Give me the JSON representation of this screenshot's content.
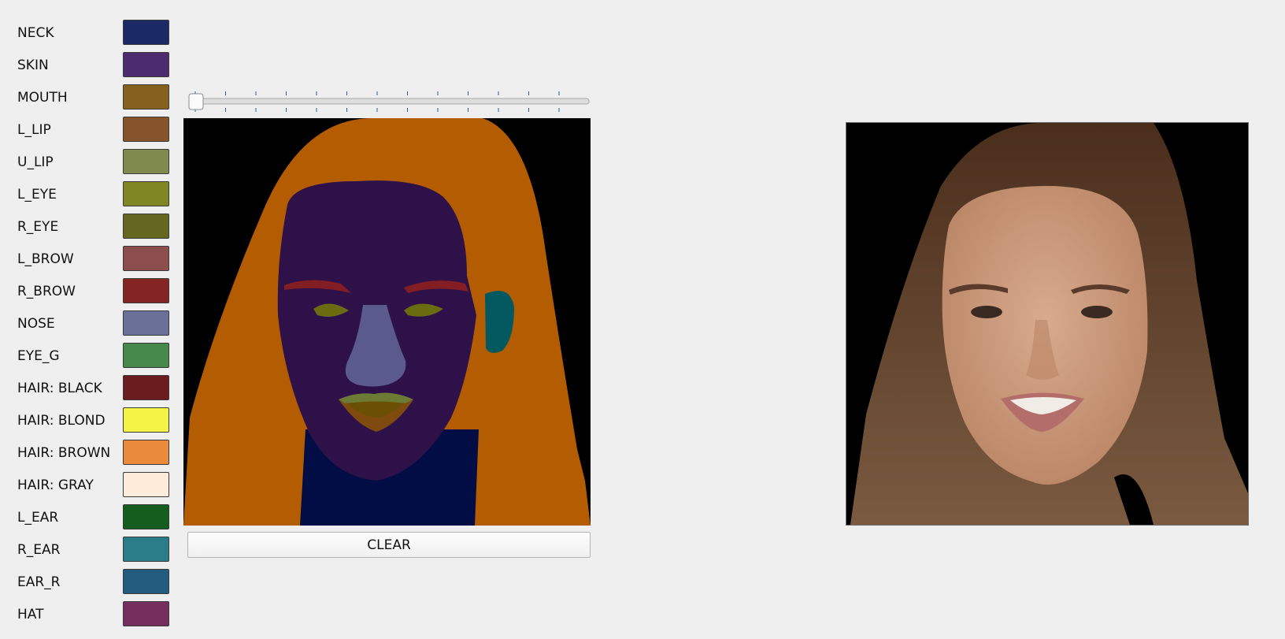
{
  "labels": [
    {
      "name": "NECK",
      "color": "#1b2a66"
    },
    {
      "name": "SKIN",
      "color": "#4c2c6e"
    },
    {
      "name": "MOUTH",
      "color": "#86601f"
    },
    {
      "name": "L_LIP",
      "color": "#86542a"
    },
    {
      "name": "U_LIP",
      "color": "#808a4f"
    },
    {
      "name": "L_EYE",
      "color": "#7f8623"
    },
    {
      "name": "R_EYE",
      "color": "#656720"
    },
    {
      "name": "L_BROW",
      "color": "#8c4e4c"
    },
    {
      "name": "R_BROW",
      "color": "#852523"
    },
    {
      "name": "NOSE",
      "color": "#6b7099"
    },
    {
      "name": "EYE_G",
      "color": "#47894c"
    },
    {
      "name": "HAIR: BLACK",
      "color": "#6a1c1f"
    },
    {
      "name": "HAIR: BLOND",
      "color": "#f4f346"
    },
    {
      "name": "HAIR: BROWN",
      "color": "#e98b3a"
    },
    {
      "name": "HAIR: GRAY",
      "color": "#feebda"
    },
    {
      "name": "L_EAR",
      "color": "#155c1f"
    },
    {
      "name": "R_EAR",
      "color": "#2b7d8a"
    },
    {
      "name": "EAR_R",
      "color": "#215b7e"
    },
    {
      "name": "HAT",
      "color": "#742d5d"
    }
  ],
  "slider": {
    "value": 0,
    "min": 0,
    "max": 12
  },
  "clear_button": "CLEAR",
  "mask_colors": {
    "background": "#000000",
    "hair": "#b45c02",
    "skin": "#2e1148",
    "neck": "#020d45",
    "brow": "#821d24",
    "eye": "#6b6b12",
    "nose": "#5a5b8c",
    "ear": "#03595f",
    "lip_upper": "#6d7a33",
    "lip_lower": "#7f4a0e",
    "mouth": "#6b4f05"
  },
  "result_colors": {
    "background": "#000000",
    "hair_dark": "#4a2e1c",
    "hair_light": "#7a5a40",
    "skin": "#d9aa8e",
    "skin_shadow": "#b98565",
    "brow": "#5a3a2a",
    "eye": "#3a2a22",
    "lips": "#b46e6a",
    "teeth": "#f2ece6"
  }
}
